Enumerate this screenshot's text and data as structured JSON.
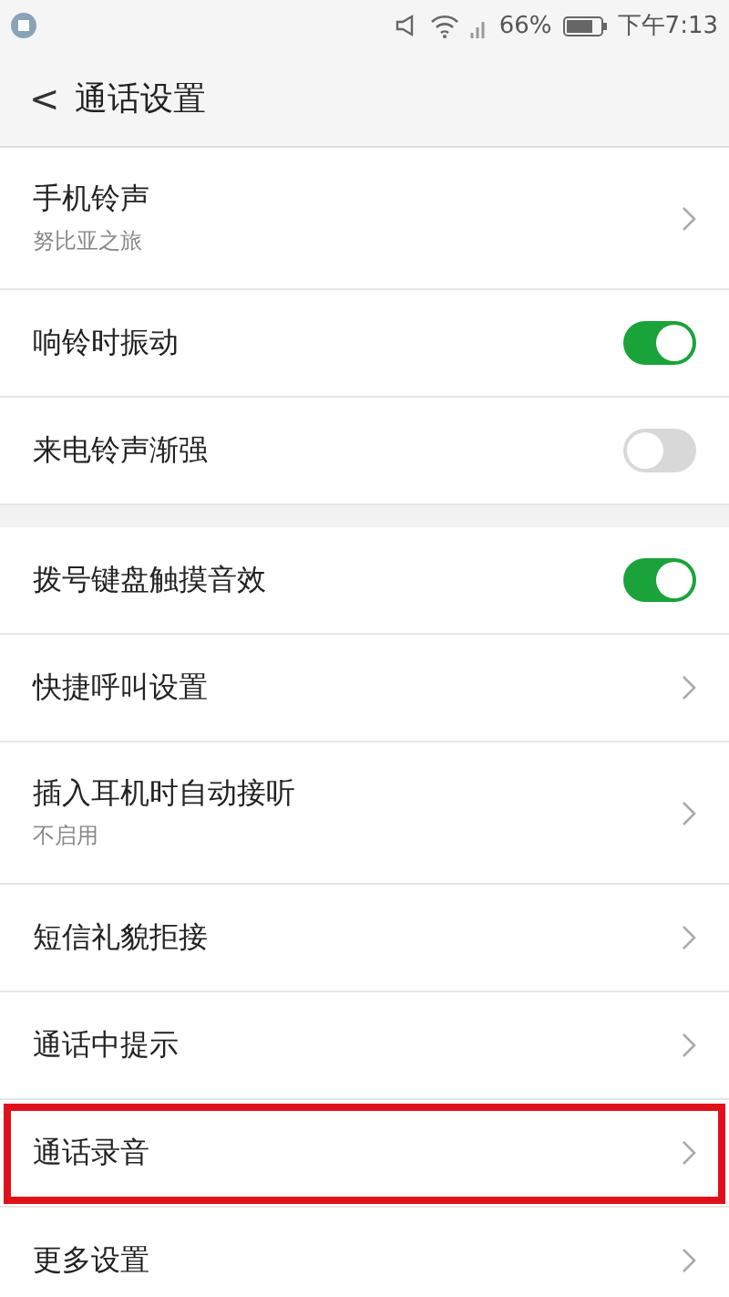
{
  "status_bar": {
    "battery_text": "66%",
    "time": "下午7:13"
  },
  "header": {
    "back": "<",
    "title": "通话设置"
  },
  "sections": [
    {
      "items": [
        {
          "kind": "link",
          "label": "手机铃声",
          "subtitle": "努比亚之旅",
          "highlighted": false
        },
        {
          "kind": "toggle",
          "label": "响铃时振动",
          "on": true,
          "highlighted": false
        },
        {
          "kind": "toggle",
          "label": "来电铃声渐强",
          "on": false,
          "highlighted": false
        }
      ]
    },
    {
      "items": [
        {
          "kind": "toggle",
          "label": "拨号键盘触摸音效",
          "on": true,
          "highlighted": false
        },
        {
          "kind": "link",
          "label": "快捷呼叫设置",
          "highlighted": false
        },
        {
          "kind": "link",
          "label": "插入耳机时自动接听",
          "subtitle": "不启用",
          "highlighted": false
        },
        {
          "kind": "link",
          "label": "短信礼貌拒接",
          "highlighted": false
        },
        {
          "kind": "link",
          "label": "通话中提示",
          "highlighted": false
        },
        {
          "kind": "link",
          "label": "通话录音",
          "highlighted": true
        },
        {
          "kind": "link",
          "label": "更多设置",
          "highlighted": false
        }
      ]
    }
  ]
}
